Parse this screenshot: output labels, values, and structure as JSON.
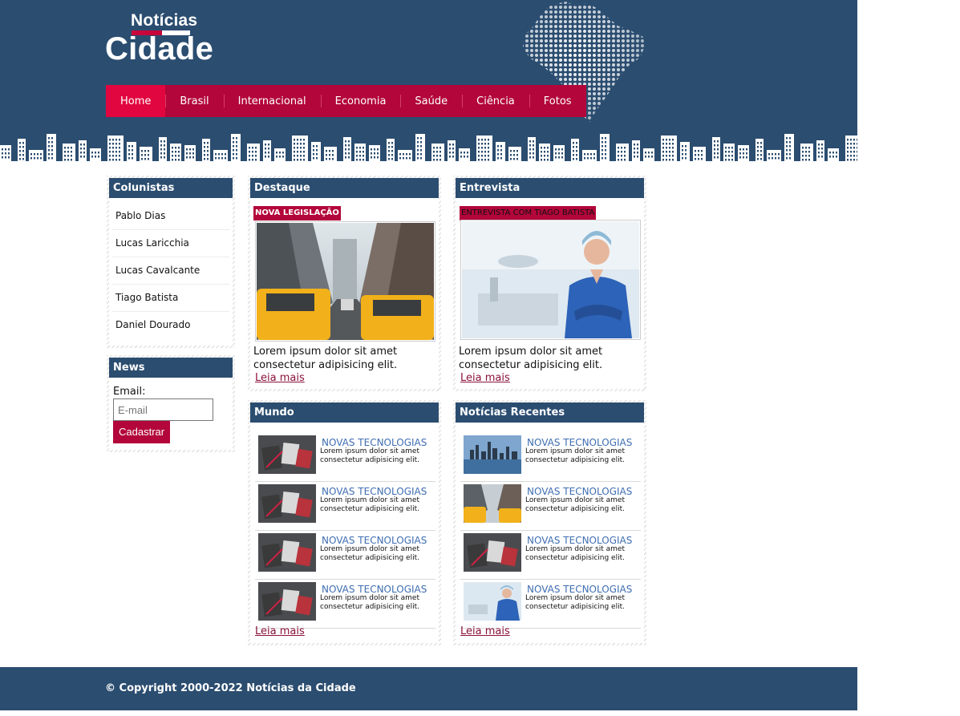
{
  "brand": {
    "top": "Notícias",
    "bottom": "Cidade"
  },
  "nav": {
    "items": [
      "Home",
      "Brasil",
      "Internacional",
      "Economia",
      "Saúde",
      "Ciência",
      "Fotos"
    ],
    "active": "Home"
  },
  "colunistas": {
    "title": "Colunistas",
    "items": [
      "Pablo Dias",
      "Lucas Laricchia",
      "Lucas Cavalcante",
      "Tiago Batista",
      "Daniel Dourado"
    ]
  },
  "news": {
    "title": "News",
    "email_label": "Email:",
    "placeholder": "E-mail",
    "button": "Cadastrar"
  },
  "destaque": {
    "title": "Destaque",
    "tag": "NOVA LEGISLAÇÃO",
    "text": "Lorem ipsum dolor sit amet consectetur adipisicing elit.",
    "more": "Leia mais"
  },
  "entrevista": {
    "title": "Entrevista",
    "tag": "ENTREVISTA COM TIAGO BATISTA",
    "text": "Lorem ipsum dolor sit amet consectetur adipisicing elit.",
    "more": "Leia mais"
  },
  "mundo": {
    "title": "Mundo",
    "items": [
      {
        "headline": "NOVAS TECNOLOGIAS",
        "text": "Lorem ipsum dolor sit amet consectetur adipisicing elit.",
        "thumb": "desk"
      },
      {
        "headline": "NOVAS TECNOLOGIAS",
        "text": "Lorem ipsum dolor sit amet consectetur adipisicing elit.",
        "thumb": "desk"
      },
      {
        "headline": "NOVAS TECNOLOGIAS",
        "text": "Lorem ipsum dolor sit amet consectetur adipisicing elit.",
        "thumb": "desk"
      },
      {
        "headline": "NOVAS TECNOLOGIAS",
        "text": "Lorem ipsum dolor sit amet consectetur adipisicing elit.",
        "thumb": "desk"
      }
    ],
    "more": "Leia mais"
  },
  "recentes": {
    "title": "Notícias Recentes",
    "items": [
      {
        "headline": "NOVAS TECNOLOGIAS",
        "text": "Lorem ipsum dolor sit amet consectetur adipisicing elit.",
        "thumb": "skyline"
      },
      {
        "headline": "NOVAS TECNOLOGIAS",
        "text": "Lorem ipsum dolor sit amet consectetur adipisicing elit.",
        "thumb": "taxi"
      },
      {
        "headline": "NOVAS TECNOLOGIAS",
        "text": "Lorem ipsum dolor sit amet consectetur adipisicing elit.",
        "thumb": "desk"
      },
      {
        "headline": "NOVAS TECNOLOGIAS",
        "text": "Lorem ipsum dolor sit amet consectetur adipisicing elit.",
        "thumb": "doctor"
      }
    ],
    "more": "Leia mais"
  },
  "footer": {
    "copyright": "© Copyright 2000-2022 Notícias da Cidade"
  },
  "colors": {
    "navy": "#2b4d70",
    "crimson": "#b3063a",
    "active": "#e1063f",
    "link": "#3f6eb2"
  }
}
